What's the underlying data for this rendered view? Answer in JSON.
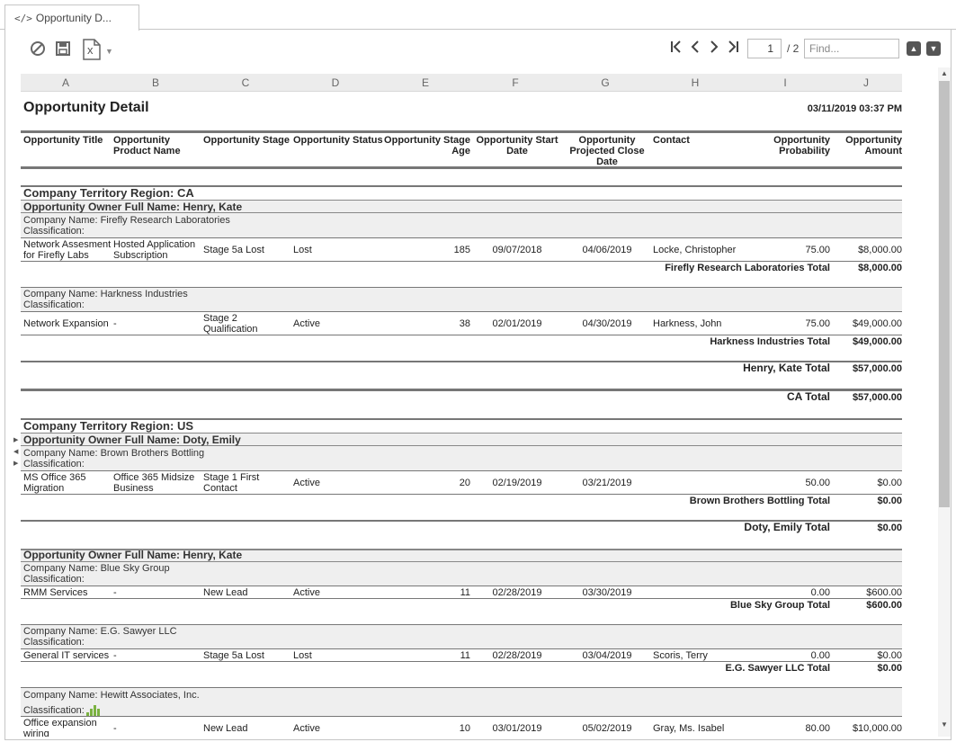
{
  "tab": {
    "label": "Opportunity D...",
    "icon": "code-icon"
  },
  "toolbar": {
    "icons": [
      "cancel-icon",
      "save-icon",
      "excel-export-icon",
      "chevron-down-icon"
    ],
    "excel_letter": "x",
    "page_value": "1",
    "page_total": "/ 2",
    "find_placeholder": "Find..."
  },
  "columns": [
    "A",
    "B",
    "C",
    "D",
    "E",
    "F",
    "G",
    "H",
    "I",
    "J"
  ],
  "report": {
    "title": "Opportunity Detail",
    "timestamp": "03/11/2019 03:37 PM",
    "headers": {
      "a": "Opportunity Title",
      "b1": "Opportunity",
      "b2": "Product Name",
      "c": "Opportunity Stage",
      "d": "Opportunity Status",
      "e1": "Opportunity Stage",
      "e2": "Age",
      "f1": "Opportunity Start",
      "f2": "Date",
      "g1": "Opportunity",
      "g2": "Projected Close",
      "g3": "Date",
      "h": "Contact",
      "i1": "Opportunity",
      "i2": "Probability",
      "j1": "Opportunity",
      "j2": "Amount"
    },
    "classification_label": "Classification:",
    "region_ca": "Company Territory Region: CA",
    "owner_henry": "Opportunity Owner Full Name: Henry, Kate",
    "cmp_firefly": "Company Name: Firefly Research Laboratories",
    "r1": {
      "a1": "Network Assesment",
      "a2": "for Firefly Labs",
      "b1": "Hosted Application",
      "b2": "Subscription",
      "c": "Stage 5a Lost",
      "d": "Lost",
      "e": "185",
      "f": "09/07/2018",
      "g": "04/06/2019",
      "h": "Locke, Christopher",
      "i": "75.00",
      "j": "$8,000.00"
    },
    "tot_firefly_label": "Firefly Research Laboratories Total",
    "tot_firefly": "$8,000.00",
    "cmp_harkness": "Company Name: Harkness Industries",
    "r2": {
      "a": "Network Expansion",
      "b": "-",
      "c1": "Stage 2",
      "c2": "Qualification",
      "d": "Active",
      "e": "38",
      "f": "02/01/2019",
      "g": "04/30/2019",
      "h": "Harkness, John",
      "i": "75.00",
      "j": "$49,000.00"
    },
    "tot_harkness_label": "Harkness Industries Total",
    "tot_harkness": "$49,000.00",
    "tot_henry_ca_label": "Henry, Kate Total",
    "tot_henry_ca": "$57,000.00",
    "tot_ca_label": "CA Total",
    "tot_ca": "$57,000.00",
    "region_us": "Company Territory Region: US",
    "owner_doty": "Opportunity Owner Full Name: Doty, Emily",
    "cmp_brown": "Company Name: Brown Brothers Bottling",
    "r3": {
      "a1": "MS Office 365",
      "a2": "Migration",
      "b1": "Office 365 Midsize",
      "b2": "Business",
      "c1": "Stage 1 First",
      "c2": "Contact",
      "d": "Active",
      "e": "20",
      "f": "02/19/2019",
      "g": "03/21/2019",
      "h": "",
      "i": "50.00",
      "j": "$0.00"
    },
    "tot_brown_label": "Brown Brothers Bottling Total",
    "tot_brown": "$0.00",
    "tot_doty_label": "Doty, Emily Total",
    "tot_doty": "$0.00",
    "owner_henry2": "Opportunity Owner Full Name: Henry, Kate",
    "cmp_bluesky": "Company Name: Blue Sky Group",
    "r4": {
      "a": "RMM Services",
      "b": "-",
      "c": "New Lead",
      "d": "Active",
      "e": "11",
      "f": "02/28/2019",
      "g": "03/30/2019",
      "h": "",
      "i": "0.00",
      "j": "$600.00"
    },
    "tot_bluesky_label": "Blue Sky Group Total",
    "tot_bluesky": "$600.00",
    "cmp_sawyer": "Company Name: E.G. Sawyer LLC",
    "r5": {
      "a": "General IT services",
      "b": "-",
      "c": "Stage 5a Lost",
      "d": "Lost",
      "e": "11",
      "f": "02/28/2019",
      "g": "03/04/2019",
      "h": "Scoris, Terry",
      "i": "0.00",
      "j": "$0.00"
    },
    "tot_sawyer_label": "E.G. Sawyer LLC Total",
    "tot_sawyer": "$0.00",
    "cmp_hewitt": "Company Name: Hewitt Associates, Inc.",
    "r6": {
      "a1": "Office expansion",
      "a2": "wiring",
      "b": "-",
      "c": "New Lead",
      "d": "Active",
      "e": "10",
      "f": "03/01/2019",
      "g": "05/02/2019",
      "h": "Gray, Ms. Isabel",
      "i": "80.00",
      "j": "$10,000.00"
    }
  },
  "colors": {
    "accent_green": "#7bb241",
    "band_gray": "#efefef"
  }
}
